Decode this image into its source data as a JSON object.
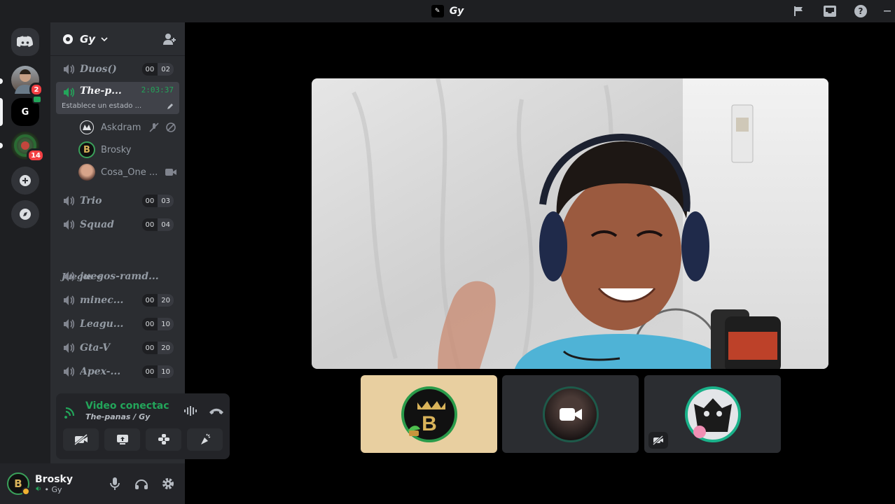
{
  "titlebar": {
    "server_badge": "✎",
    "title": "Gy"
  },
  "guilds": {
    "dm_badge": "2",
    "server3_badge": "14"
  },
  "server": {
    "name": "Gy"
  },
  "channels": [
    {
      "name": "Duos()",
      "count_a": "00",
      "count_b": "02"
    },
    {
      "name": "The-p...",
      "timer": "2:03:37",
      "status": "Establece un estado ..."
    },
    {
      "name": "Trio",
      "count_a": "00",
      "count_b": "03"
    },
    {
      "name": "Squad",
      "count_a": "00",
      "count_b": "04"
    }
  ],
  "voice_users": [
    {
      "name": "Askdram"
    },
    {
      "name": "Brosky"
    },
    {
      "name": "Cosa_One ..."
    }
  ],
  "category": {
    "label": "Juegos"
  },
  "game_channels": [
    {
      "name": "juegos-ramd..."
    },
    {
      "name": "minec...",
      "count_a": "00",
      "count_b": "20"
    },
    {
      "name": "Leagu...",
      "count_a": "00",
      "count_b": "10"
    },
    {
      "name": "Gta-V",
      "count_a": "00",
      "count_b": "20"
    },
    {
      "name": "Apex-...",
      "count_a": "00",
      "count_b": "10"
    }
  ],
  "voice_panel": {
    "title": "Video conectac",
    "subtitle": "The-panas / Gy"
  },
  "user": {
    "name": "Brosky",
    "status": "• Gy"
  },
  "colors": {
    "accent_green": "#23a55a",
    "danger": "#f23f43",
    "bg_dark": "#1e1f22",
    "sidebar": "#2b2d31"
  }
}
